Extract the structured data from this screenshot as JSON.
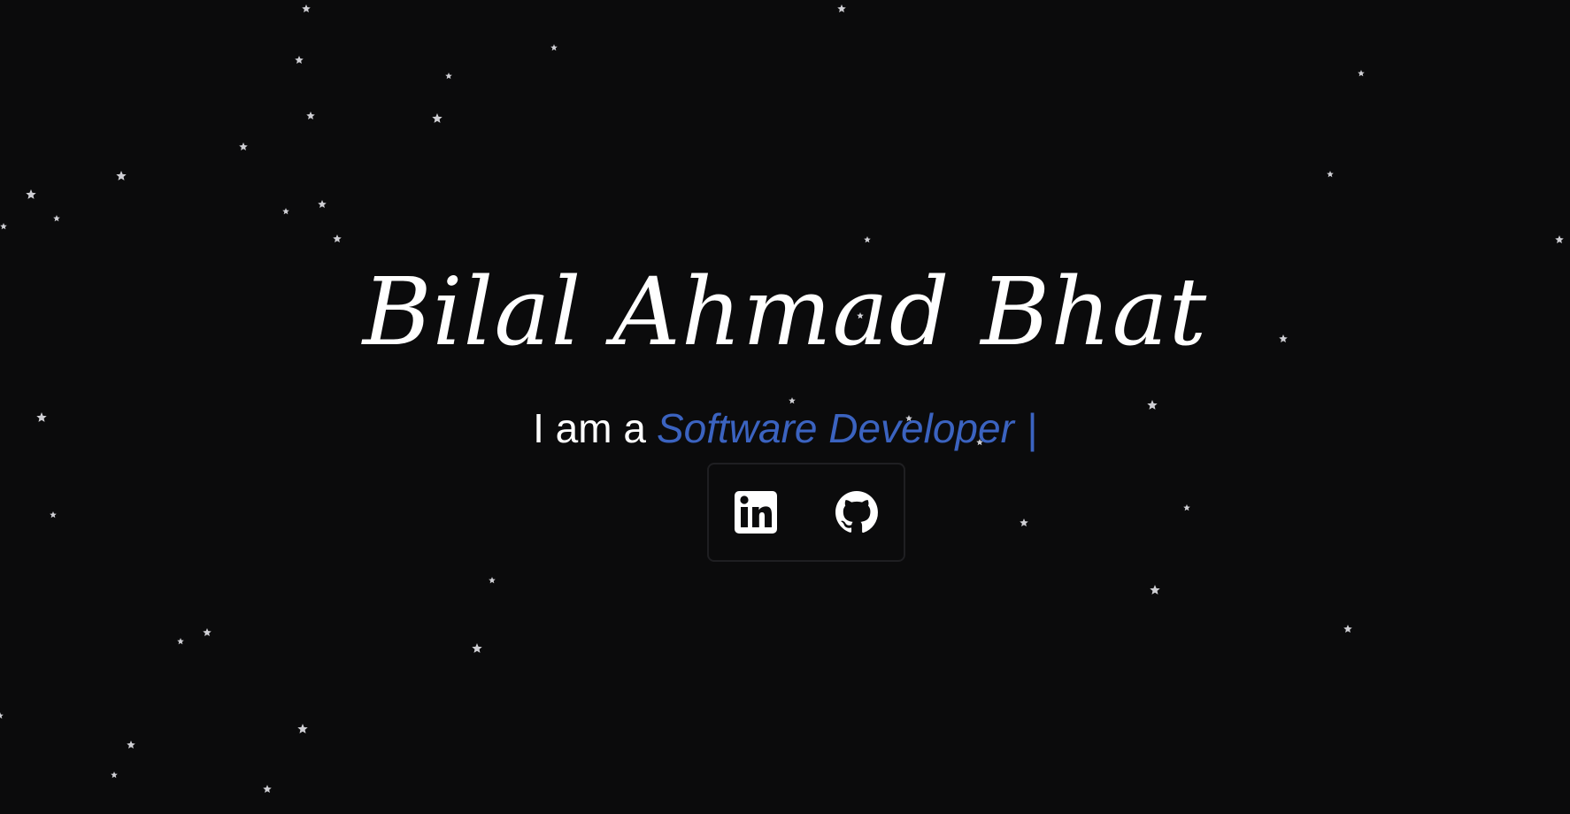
{
  "hero": {
    "name": "Bilal Ahmad Bhat",
    "intro": "I am a",
    "role": "Software Developer",
    "cursor": "|",
    "accent_color": "#3b63c0",
    "background_color": "#0b0b0c",
    "star_color": "#cfcfd4"
  },
  "social": {
    "links": [
      {
        "icon": "linkedin-icon"
      },
      {
        "icon": "github-icon"
      }
    ]
  }
}
